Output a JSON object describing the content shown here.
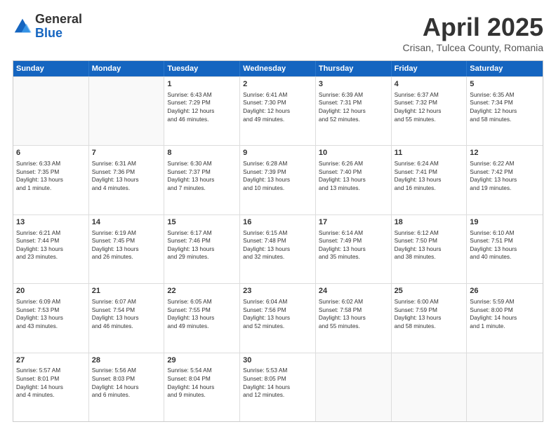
{
  "header": {
    "logo_general": "General",
    "logo_blue": "Blue",
    "month_title": "April 2025",
    "subtitle": "Crisan, Tulcea County, Romania"
  },
  "weekdays": [
    "Sunday",
    "Monday",
    "Tuesday",
    "Wednesday",
    "Thursday",
    "Friday",
    "Saturday"
  ],
  "rows": [
    [
      {
        "day": "",
        "info": ""
      },
      {
        "day": "",
        "info": ""
      },
      {
        "day": "1",
        "info": "Sunrise: 6:43 AM\nSunset: 7:29 PM\nDaylight: 12 hours\nand 46 minutes."
      },
      {
        "day": "2",
        "info": "Sunrise: 6:41 AM\nSunset: 7:30 PM\nDaylight: 12 hours\nand 49 minutes."
      },
      {
        "day": "3",
        "info": "Sunrise: 6:39 AM\nSunset: 7:31 PM\nDaylight: 12 hours\nand 52 minutes."
      },
      {
        "day": "4",
        "info": "Sunrise: 6:37 AM\nSunset: 7:32 PM\nDaylight: 12 hours\nand 55 minutes."
      },
      {
        "day": "5",
        "info": "Sunrise: 6:35 AM\nSunset: 7:34 PM\nDaylight: 12 hours\nand 58 minutes."
      }
    ],
    [
      {
        "day": "6",
        "info": "Sunrise: 6:33 AM\nSunset: 7:35 PM\nDaylight: 13 hours\nand 1 minute."
      },
      {
        "day": "7",
        "info": "Sunrise: 6:31 AM\nSunset: 7:36 PM\nDaylight: 13 hours\nand 4 minutes."
      },
      {
        "day": "8",
        "info": "Sunrise: 6:30 AM\nSunset: 7:37 PM\nDaylight: 13 hours\nand 7 minutes."
      },
      {
        "day": "9",
        "info": "Sunrise: 6:28 AM\nSunset: 7:39 PM\nDaylight: 13 hours\nand 10 minutes."
      },
      {
        "day": "10",
        "info": "Sunrise: 6:26 AM\nSunset: 7:40 PM\nDaylight: 13 hours\nand 13 minutes."
      },
      {
        "day": "11",
        "info": "Sunrise: 6:24 AM\nSunset: 7:41 PM\nDaylight: 13 hours\nand 16 minutes."
      },
      {
        "day": "12",
        "info": "Sunrise: 6:22 AM\nSunset: 7:42 PM\nDaylight: 13 hours\nand 19 minutes."
      }
    ],
    [
      {
        "day": "13",
        "info": "Sunrise: 6:21 AM\nSunset: 7:44 PM\nDaylight: 13 hours\nand 23 minutes."
      },
      {
        "day": "14",
        "info": "Sunrise: 6:19 AM\nSunset: 7:45 PM\nDaylight: 13 hours\nand 26 minutes."
      },
      {
        "day": "15",
        "info": "Sunrise: 6:17 AM\nSunset: 7:46 PM\nDaylight: 13 hours\nand 29 minutes."
      },
      {
        "day": "16",
        "info": "Sunrise: 6:15 AM\nSunset: 7:48 PM\nDaylight: 13 hours\nand 32 minutes."
      },
      {
        "day": "17",
        "info": "Sunrise: 6:14 AM\nSunset: 7:49 PM\nDaylight: 13 hours\nand 35 minutes."
      },
      {
        "day": "18",
        "info": "Sunrise: 6:12 AM\nSunset: 7:50 PM\nDaylight: 13 hours\nand 38 minutes."
      },
      {
        "day": "19",
        "info": "Sunrise: 6:10 AM\nSunset: 7:51 PM\nDaylight: 13 hours\nand 40 minutes."
      }
    ],
    [
      {
        "day": "20",
        "info": "Sunrise: 6:09 AM\nSunset: 7:53 PM\nDaylight: 13 hours\nand 43 minutes."
      },
      {
        "day": "21",
        "info": "Sunrise: 6:07 AM\nSunset: 7:54 PM\nDaylight: 13 hours\nand 46 minutes."
      },
      {
        "day": "22",
        "info": "Sunrise: 6:05 AM\nSunset: 7:55 PM\nDaylight: 13 hours\nand 49 minutes."
      },
      {
        "day": "23",
        "info": "Sunrise: 6:04 AM\nSunset: 7:56 PM\nDaylight: 13 hours\nand 52 minutes."
      },
      {
        "day": "24",
        "info": "Sunrise: 6:02 AM\nSunset: 7:58 PM\nDaylight: 13 hours\nand 55 minutes."
      },
      {
        "day": "25",
        "info": "Sunrise: 6:00 AM\nSunset: 7:59 PM\nDaylight: 13 hours\nand 58 minutes."
      },
      {
        "day": "26",
        "info": "Sunrise: 5:59 AM\nSunset: 8:00 PM\nDaylight: 14 hours\nand 1 minute."
      }
    ],
    [
      {
        "day": "27",
        "info": "Sunrise: 5:57 AM\nSunset: 8:01 PM\nDaylight: 14 hours\nand 4 minutes."
      },
      {
        "day": "28",
        "info": "Sunrise: 5:56 AM\nSunset: 8:03 PM\nDaylight: 14 hours\nand 6 minutes."
      },
      {
        "day": "29",
        "info": "Sunrise: 5:54 AM\nSunset: 8:04 PM\nDaylight: 14 hours\nand 9 minutes."
      },
      {
        "day": "30",
        "info": "Sunrise: 5:53 AM\nSunset: 8:05 PM\nDaylight: 14 hours\nand 12 minutes."
      },
      {
        "day": "",
        "info": ""
      },
      {
        "day": "",
        "info": ""
      },
      {
        "day": "",
        "info": ""
      }
    ]
  ]
}
